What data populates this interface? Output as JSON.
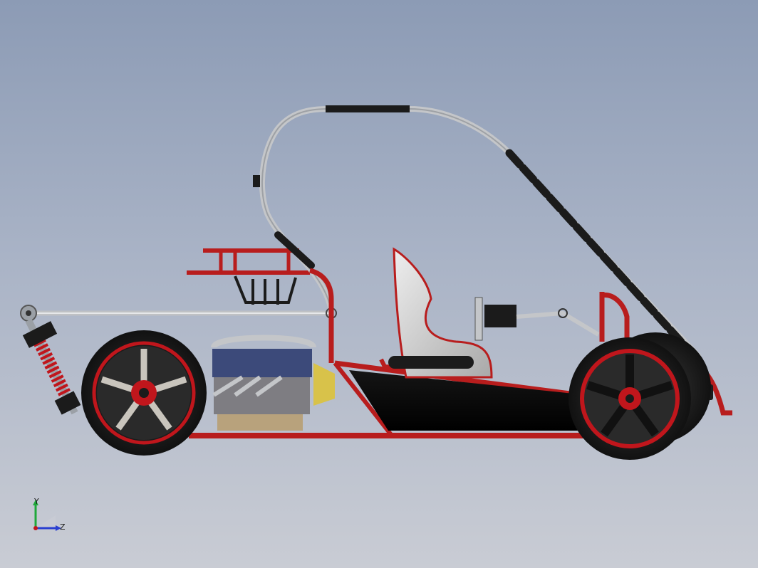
{
  "scene": {
    "model": "buggy-side-view",
    "background": {
      "top": "#8c9bb5",
      "bottom": "#c9ccd4"
    },
    "colors": {
      "frame_red": "#b81d1d",
      "dark_red": "#7a0f0f",
      "roll_bar_gray": "#c4c6c9",
      "grip_black": "#1b1b1b",
      "tire_black": "#1a1a1a",
      "rim_red": "#c0161c",
      "seat_gray": "#d9d9d9",
      "engine_blue": "#3c4a7a",
      "engine_tan": "#b8a27c"
    }
  },
  "triad": {
    "y_label": "Y",
    "z_label": "Z",
    "y_color": "#1fa83a",
    "z_color": "#2a3fd0"
  }
}
